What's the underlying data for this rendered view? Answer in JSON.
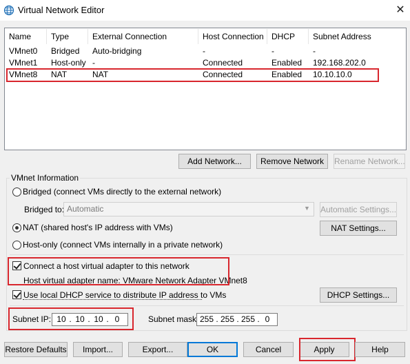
{
  "window": {
    "title": "Virtual Network Editor",
    "app_icon": "network-globe-icon",
    "close_glyph": "✕"
  },
  "network_table": {
    "columns": [
      "Name",
      "Type",
      "External Connection",
      "Host Connection",
      "DHCP",
      "Subnet Address"
    ],
    "rows": [
      [
        "VMnet0",
        "Bridged",
        "Auto-bridging",
        "-",
        "-",
        "-"
      ],
      [
        "VMnet1",
        "Host-only",
        "-",
        "Connected",
        "Enabled",
        "192.168.202.0"
      ],
      [
        "VMnet8",
        "NAT",
        "NAT",
        "Connected",
        "Enabled",
        "10.10.10.0"
      ]
    ],
    "selected_row": "VMnet8"
  },
  "table_buttons": {
    "add": "Add Network...",
    "remove": "Remove Network",
    "rename": "Rename Network..."
  },
  "vmnet_info": {
    "group_label": "VMnet Information",
    "bridged_label": "Bridged (connect VMs directly to the external network)",
    "bridged_to_label": "Bridged to:",
    "bridged_to_value": "Automatic",
    "auto_settings": "Automatic Settings...",
    "nat_label": "NAT (shared host's IP address with VMs)",
    "nat_settings": "NAT Settings...",
    "hostonly_label": "Host-only (connect VMs internally in a private network)",
    "connect_adapter_label": "Connect a host virtual adapter to this network",
    "adapter_name_label": "Host virtual adapter name: VMware Network Adapter VMnet8",
    "dhcp_label": "Use local DHCP service to distribute IP address to VMs",
    "dhcp_settings": "DHCP Settings...",
    "subnet_ip_label": "Subnet IP:",
    "subnet_ip": [
      "10",
      "10",
      "10",
      "0"
    ],
    "subnet_mask_label": "Subnet mask:",
    "subnet_mask": [
      "255",
      "255",
      "255",
      "0"
    ],
    "ip_separator": "."
  },
  "bottom_buttons": {
    "restore": "Restore Defaults",
    "import": "Import...",
    "export": "Export...",
    "ok": "OK",
    "cancel": "Cancel",
    "apply": "Apply",
    "help": "Help"
  },
  "colors": {
    "highlight_red": "#d8262d",
    "focus_blue": "#0078d7"
  }
}
